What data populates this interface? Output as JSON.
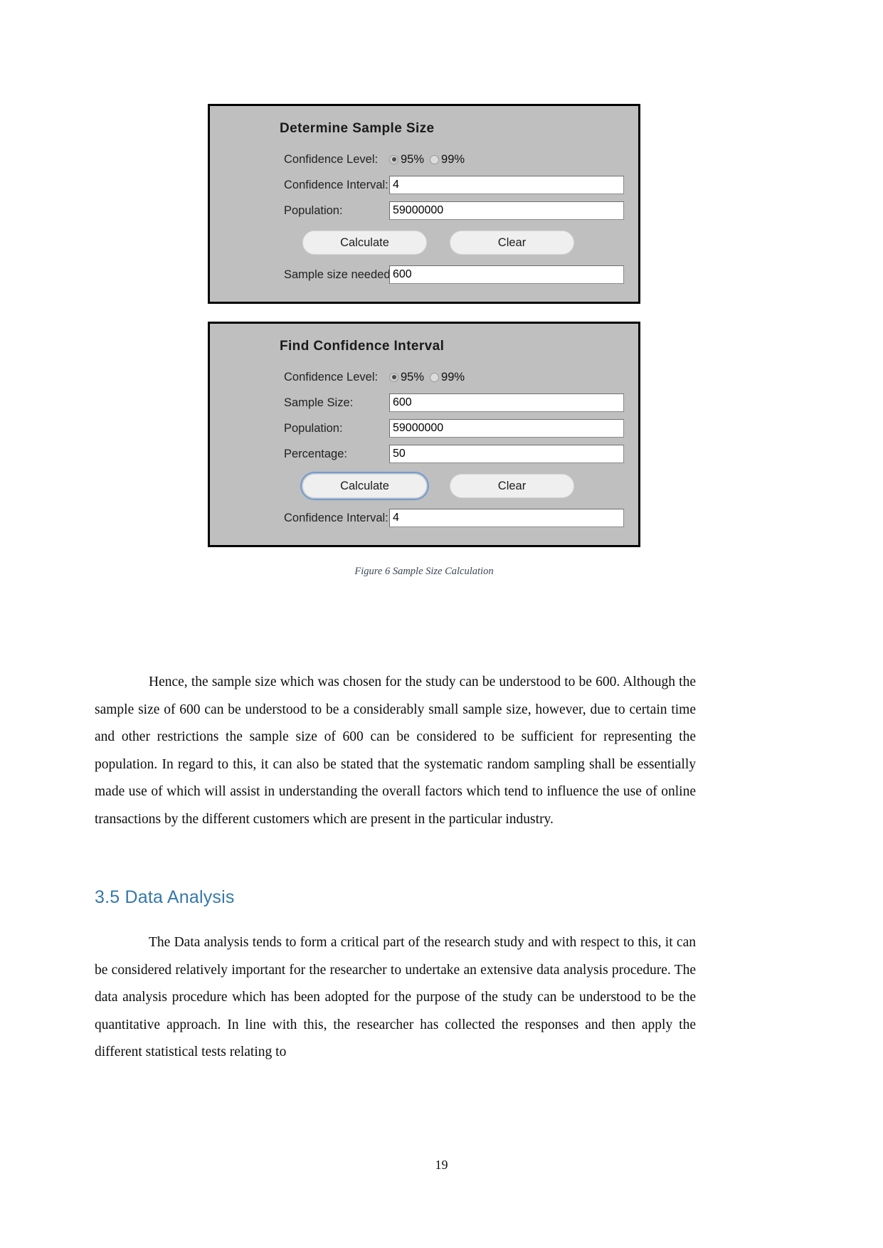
{
  "figure": {
    "panels": [
      {
        "title": "Determine Sample Size",
        "rows": [
          {
            "label": "Confidence Level:",
            "type": "radio",
            "options": [
              {
                "label": "95%",
                "checked": true
              },
              {
                "label": "99%",
                "checked": false
              }
            ]
          },
          {
            "label": "Confidence Interval:",
            "type": "text",
            "value": "4"
          },
          {
            "label": "Population:",
            "type": "text",
            "value": "59000000"
          }
        ],
        "buttons": [
          {
            "label": "Calculate",
            "focused": false
          },
          {
            "label": "Clear",
            "focused": false
          }
        ],
        "result": {
          "label": "Sample size needed:",
          "value": "600"
        }
      },
      {
        "title": "Find Confidence Interval",
        "rows": [
          {
            "label": "Confidence Level:",
            "type": "radio",
            "options": [
              {
                "label": "95%",
                "checked": true
              },
              {
                "label": "99%",
                "checked": false
              }
            ]
          },
          {
            "label": "Sample Size:",
            "type": "text",
            "value": "600"
          },
          {
            "label": "Population:",
            "type": "text",
            "value": "59000000"
          },
          {
            "label": "Percentage:",
            "type": "text",
            "value": "50"
          }
        ],
        "buttons": [
          {
            "label": "Calculate",
            "focused": true
          },
          {
            "label": "Clear",
            "focused": false
          }
        ],
        "result": {
          "label": "Confidence Interval:",
          "value": "4"
        }
      }
    ],
    "caption": "Figure 6 Sample Size Calculation"
  },
  "body": {
    "paragraph_1": "Hence, the sample size which was chosen for the study can be understood to be 600. Although the sample size of 600 can be understood to be a considerably small sample size, however, due to certain time and other restrictions the sample size of 600 can be considered to be sufficient for representing the population. In regard to this, it can also be stated that the systematic random sampling shall be essentially made use of which will assist in understanding the overall factors which tend to influence the use of online transactions by the different customers which are present in the particular industry.",
    "heading_3_5": "3.5 Data Analysis",
    "paragraph_2": "The Data analysis tends to form a critical part of the research study and with respect to this, it can be considered relatively important for the researcher to undertake an extensive data analysis procedure. The data analysis procedure which has been adopted for the purpose of the study can be understood to be the quantitative approach. In line with this, the researcher has collected the responses and then apply the different statistical tests relating to"
  },
  "footer": {
    "page_number": "19"
  },
  "colors": {
    "heading_blue": "#3478ab",
    "panel_background": "#bfbfbf",
    "panel_border": "#000000",
    "caption_color": "#3c4656",
    "focus_ring": "#6e9ed4"
  }
}
